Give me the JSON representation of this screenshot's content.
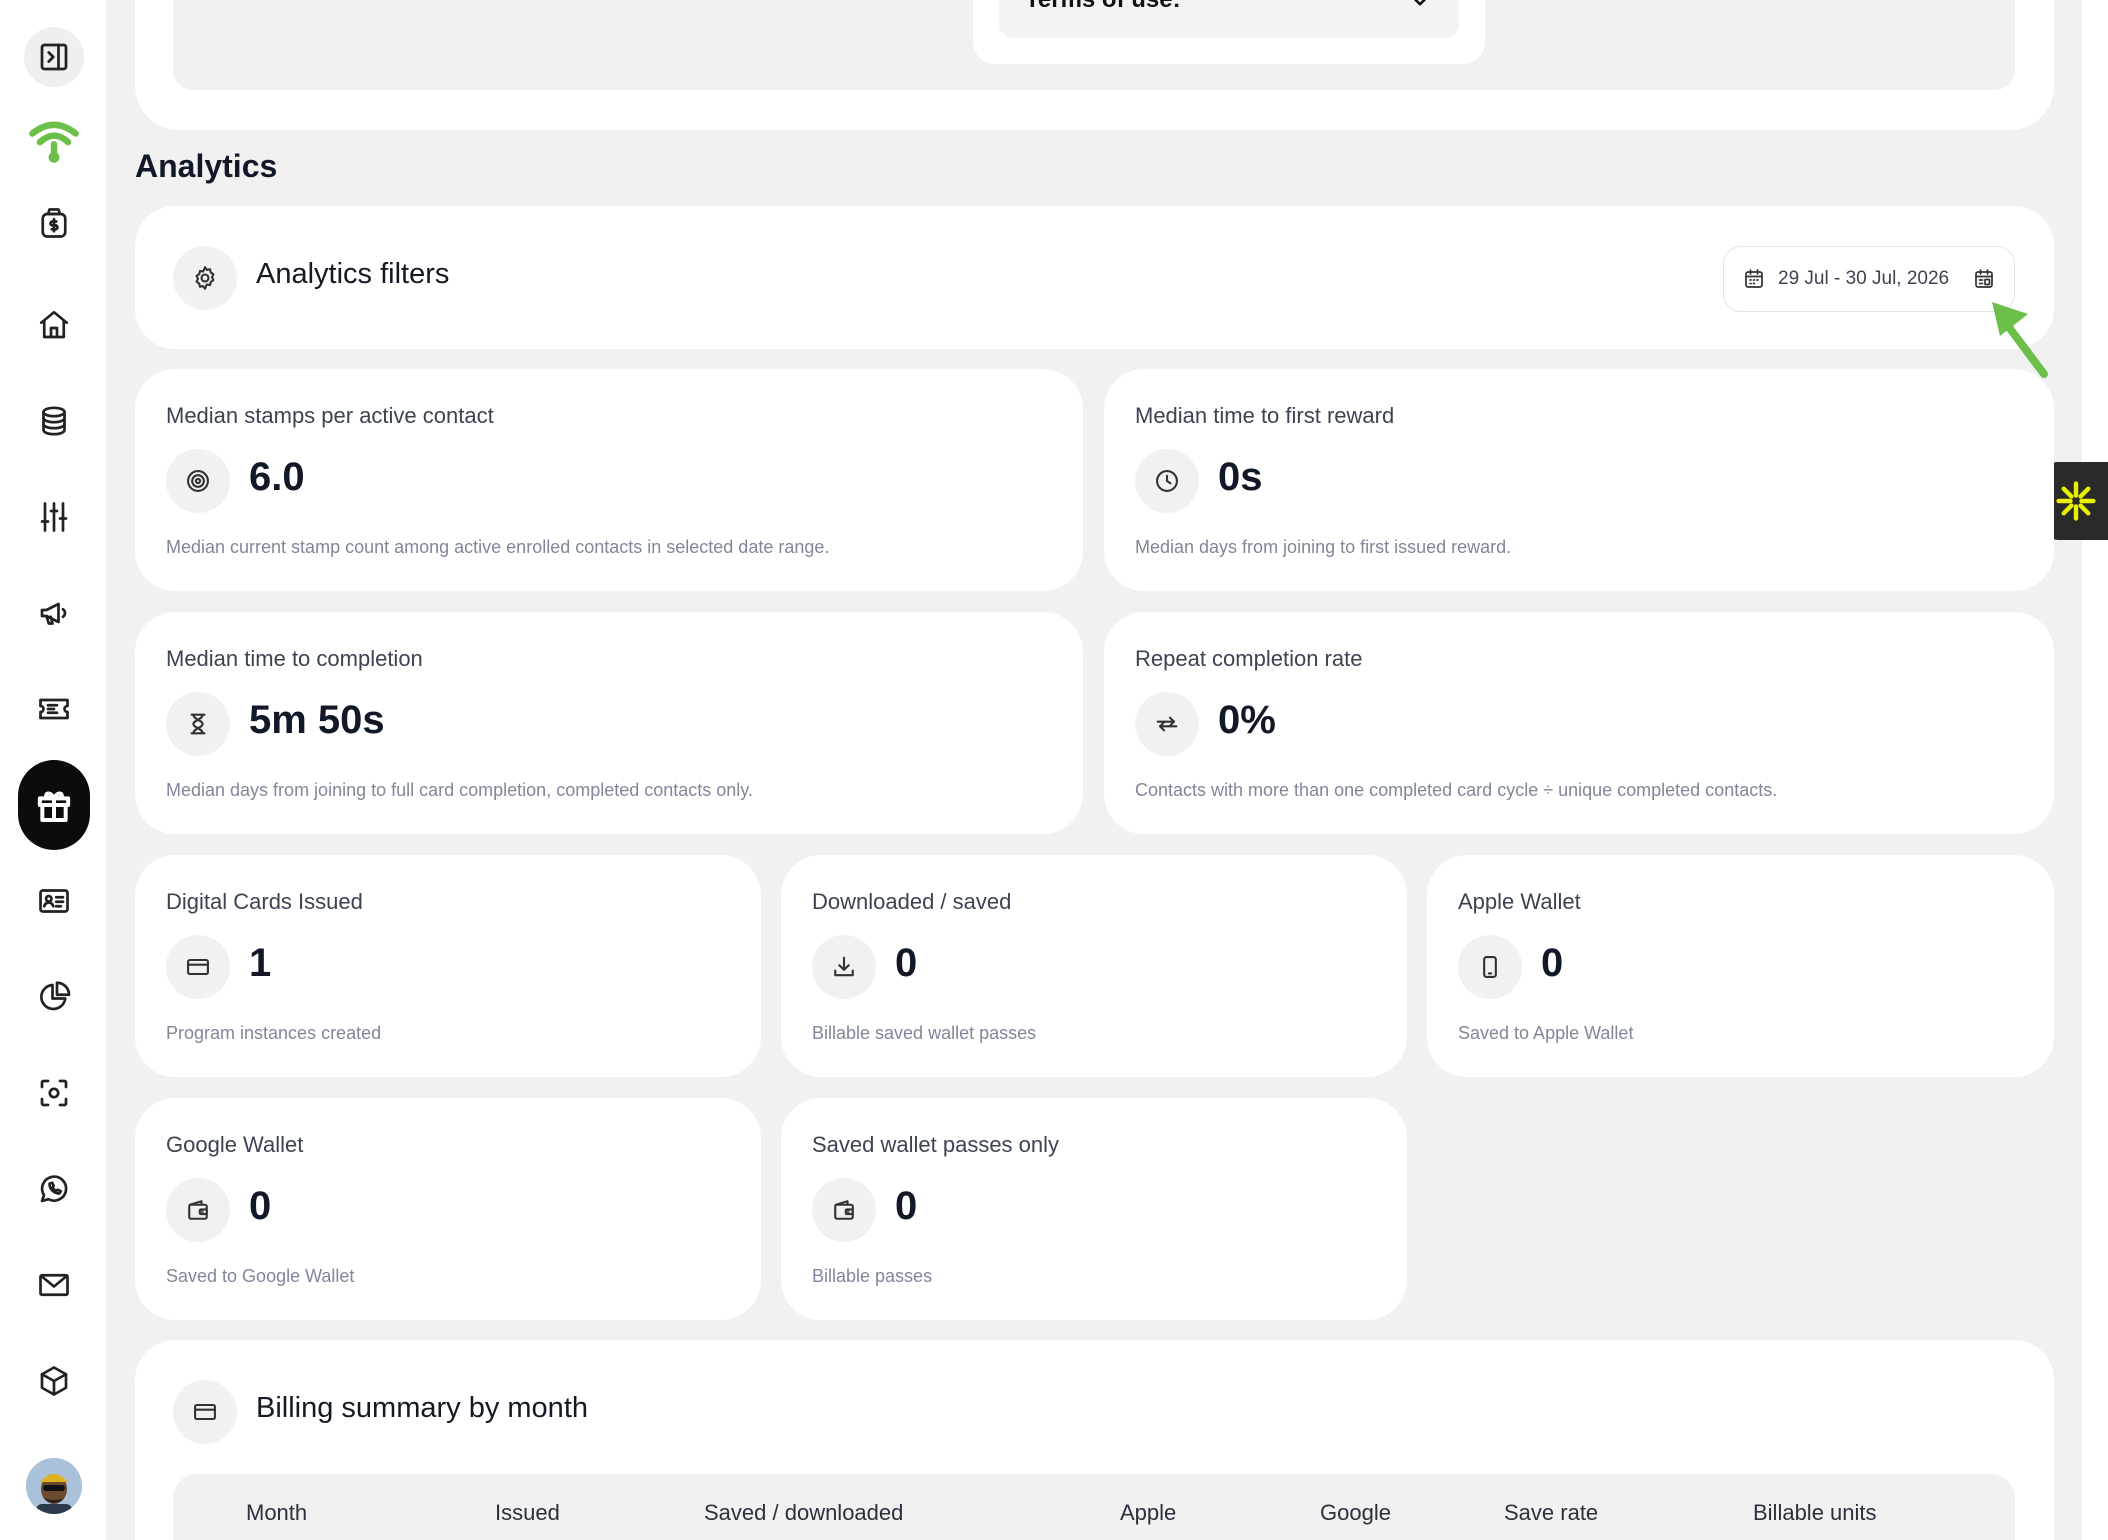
{
  "sidebar": {
    "items": [
      {
        "name": "sidebar-toggle-icon"
      },
      {
        "name": "wifi-logo-icon"
      },
      {
        "name": "money-bag-icon"
      },
      {
        "name": "home-icon"
      },
      {
        "name": "database-icon"
      },
      {
        "name": "sliders-icon"
      },
      {
        "name": "megaphone-icon"
      },
      {
        "name": "ticket-icon"
      },
      {
        "name": "gift-icon",
        "active": true
      },
      {
        "name": "id-card-icon"
      },
      {
        "name": "pie-chart-icon"
      },
      {
        "name": "scan-icon"
      },
      {
        "name": "whatsapp-icon"
      },
      {
        "name": "mail-icon"
      },
      {
        "name": "box-icon"
      }
    ],
    "avatar_icon": "user-avatar"
  },
  "top": {
    "terms_label": "Terms of use:"
  },
  "analytics": {
    "title": "Analytics",
    "filters_title": "Analytics filters",
    "date_range": "29 Jul - 30 Jul, 2026"
  },
  "cards": {
    "median_stamps": {
      "title": "Median stamps per active contact",
      "value": "6.0",
      "desc": "Median current stamp count among active enrolled contacts in selected date range.",
      "icon": "target-icon"
    },
    "time_first_reward": {
      "title": "Median time to first reward",
      "value": "0s",
      "desc": "Median days from joining to first issued reward.",
      "icon": "clock-icon"
    },
    "time_completion": {
      "title": "Median time to completion",
      "value": "5m 50s",
      "desc": "Median days from joining to full card completion, completed contacts only.",
      "icon": "hourglass-icon"
    },
    "repeat_rate": {
      "title": "Repeat completion rate",
      "value": "0%",
      "desc": "Contacts with more than one completed card cycle ÷ unique completed contacts.",
      "icon": "repeat-icon"
    },
    "cards_issued": {
      "title": "Digital Cards Issued",
      "value": "1",
      "desc": "Program instances created",
      "icon": "credit-card-icon"
    },
    "downloaded": {
      "title": "Downloaded / saved",
      "value": "0",
      "desc": "Billable saved wallet passes",
      "icon": "download-icon"
    },
    "apple_wallet": {
      "title": "Apple Wallet",
      "value": "0",
      "desc": "Saved to Apple Wallet",
      "icon": "phone-icon"
    },
    "google_wallet": {
      "title": "Google Wallet",
      "value": "0",
      "desc": "Saved to Google Wallet",
      "icon": "wallet-icon"
    },
    "saved_only": {
      "title": "Saved wallet passes only",
      "value": "0",
      "desc": "Billable passes",
      "icon": "wallet-icon"
    }
  },
  "billing": {
    "title": "Billing summary by month",
    "columns": [
      "Month",
      "Issued",
      "Saved / downloaded",
      "Apple",
      "Google",
      "Save rate",
      "Billable units"
    ]
  },
  "colors": {
    "accent_green": "#6cc04a",
    "spark_yellow": "#e8f000",
    "background": "#f1f1f1"
  }
}
